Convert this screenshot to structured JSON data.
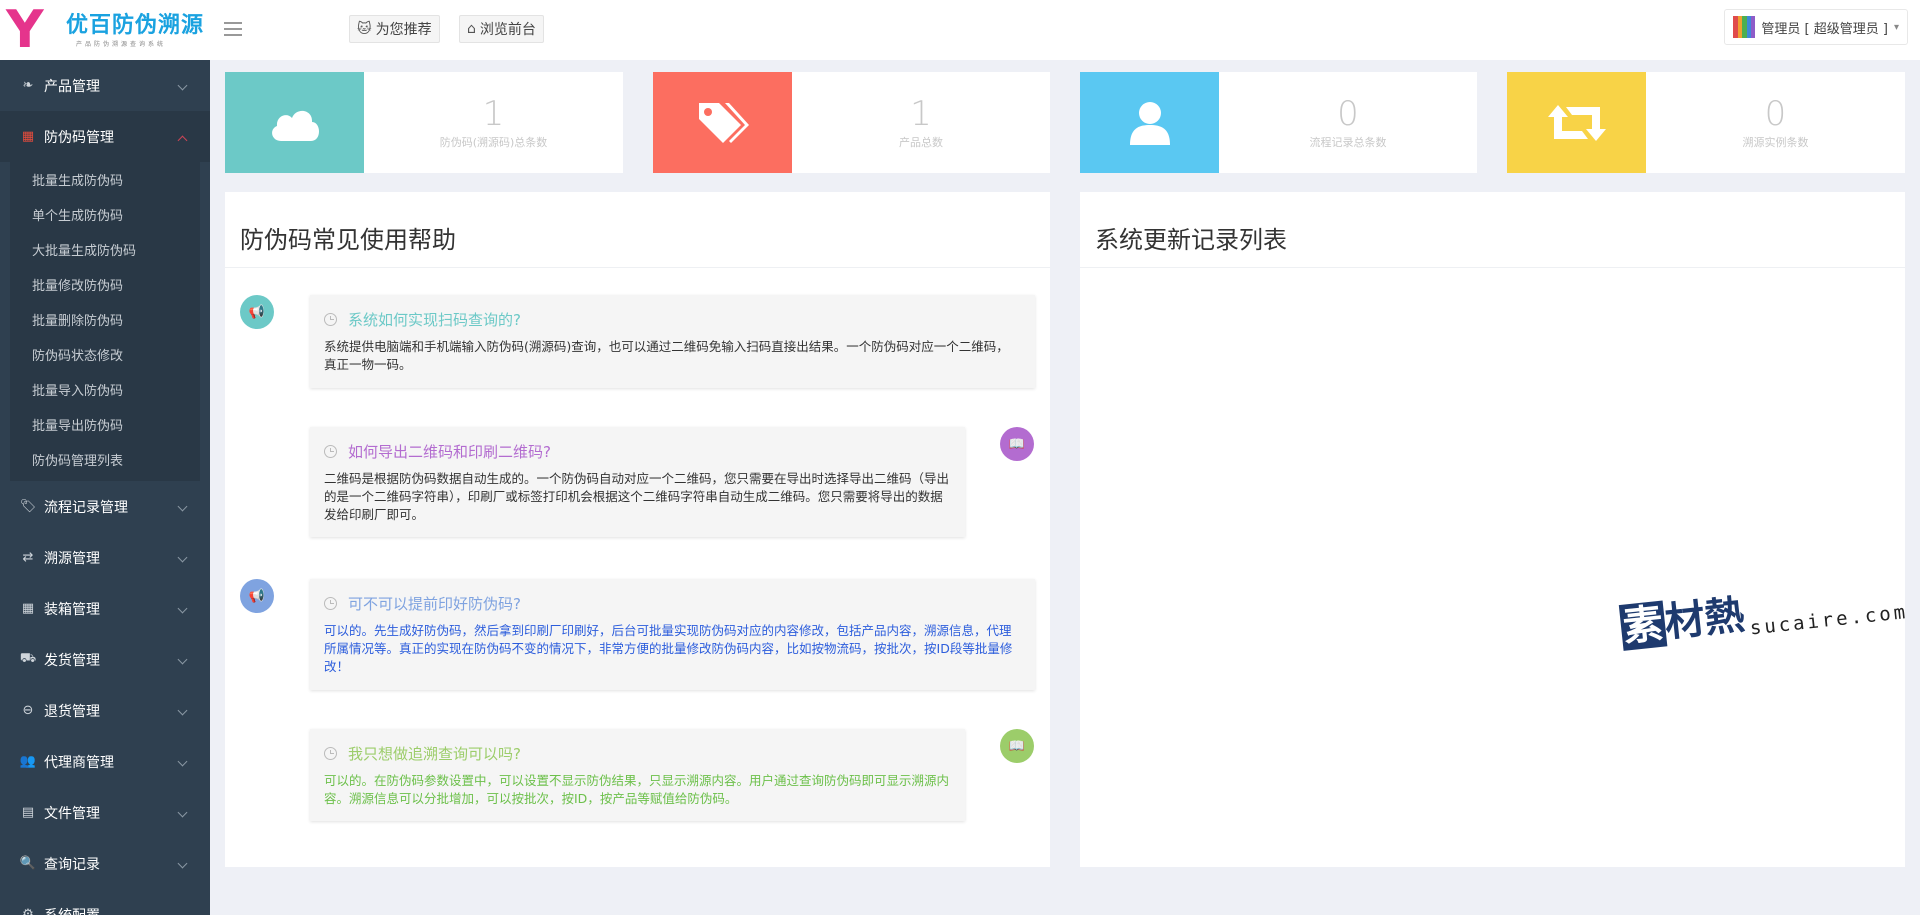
{
  "header": {
    "logo_letter": "Y",
    "logo_title": "优百防伪溯源",
    "logo_subtitle": "产品防伪溯源查询系统",
    "recommend_label": "为您推荐",
    "browse_label": "浏览前台",
    "user_label": "管理员 [ 超级管理员 ]"
  },
  "sidebar": {
    "items": [
      {
        "label": "产品管理"
      },
      {
        "label": "防伪码管理",
        "open": true
      }
    ],
    "submenu": [
      "批量生成防伪码",
      "单个生成防伪码",
      "大批量生成防伪码",
      "批量修改防伪码",
      "批量删除防伪码",
      "防伪码状态修改",
      "批量导入防伪码",
      "批量导出防伪码",
      "防伪码管理列表"
    ],
    "rest": [
      {
        "label": "流程记录管理"
      },
      {
        "label": "溯源管理"
      },
      {
        "label": "装箱管理"
      },
      {
        "label": "发货管理"
      },
      {
        "label": "退货管理"
      },
      {
        "label": "代理商管理"
      },
      {
        "label": "文件管理"
      },
      {
        "label": "查询记录"
      },
      {
        "label": "系统配置"
      }
    ]
  },
  "stats": [
    {
      "value": "1",
      "label": "防伪码(溯源码)总条数",
      "color": "#6cc9c7"
    },
    {
      "value": "1",
      "label": "产品总数",
      "color": "#fc6e60"
    },
    {
      "value": "0",
      "label": "流程记录总条数",
      "color": "#5ac8f2"
    },
    {
      "value": "0",
      "label": "溯源实例条数",
      "color": "#f8d347"
    }
  ],
  "help_panel": {
    "title": "防伪码常见使用帮助",
    "entries": [
      {
        "question": "系统如何实现扫码查询的?",
        "answer": "系统提供电脑端和手机端输入防伪码(溯源码)查询，也可以通过二维码免输入扫码直接出结果。一个防伪码对应一个二维码，真正一物一码。",
        "title_color": "#6cc9c7",
        "text_color": "#333333"
      },
      {
        "question": "如何导出二维码和印刷二维码?",
        "answer": "二维码是根据防伪码数据自动生成的。一个防伪码自动对应一个二维码，您只需要在导出时选择导出二维码（导出的是一个二维码字符串），印刷厂或标签打印机会根据这个二维码字符串自动生成二维码。您只需要将导出的数据发给印刷厂即可。",
        "title_color": "#b36cd0",
        "text_color": "#333333"
      },
      {
        "question": "可不可以提前印好防伪码?",
        "answer": "可以的。先生成好防伪码，然后拿到印刷厂印刷好，后台可批量实现防伪码对应的内容修改，包括产品内容，溯源信息，代理所属情况等。真正的实现在防伪码不变的情况下，非常方便的批量修改防伪码内容，比如按物流码，按批次，按ID段等批量修改！",
        "title_color": "#7fa3e0",
        "text_color": "#2c5ddc"
      },
      {
        "question": "我只想做追溯查询可以吗?",
        "answer": "可以的。在防伪码参数设置中，可以设置不显示防伪结果，只显示溯源内容。用户通过查询防伪码即可显示溯源内容。溯源信息可以分批增加，可以按批次，按ID，按产品等赋值给防伪码。",
        "title_color": "#9ccd6a",
        "text_color": "#6cc04a"
      }
    ]
  },
  "update_panel": {
    "title": "系统更新记录列表"
  },
  "watermark": {
    "zh_first": "素",
    "zh_rest": "材熱",
    "en": "sucaire.com"
  }
}
